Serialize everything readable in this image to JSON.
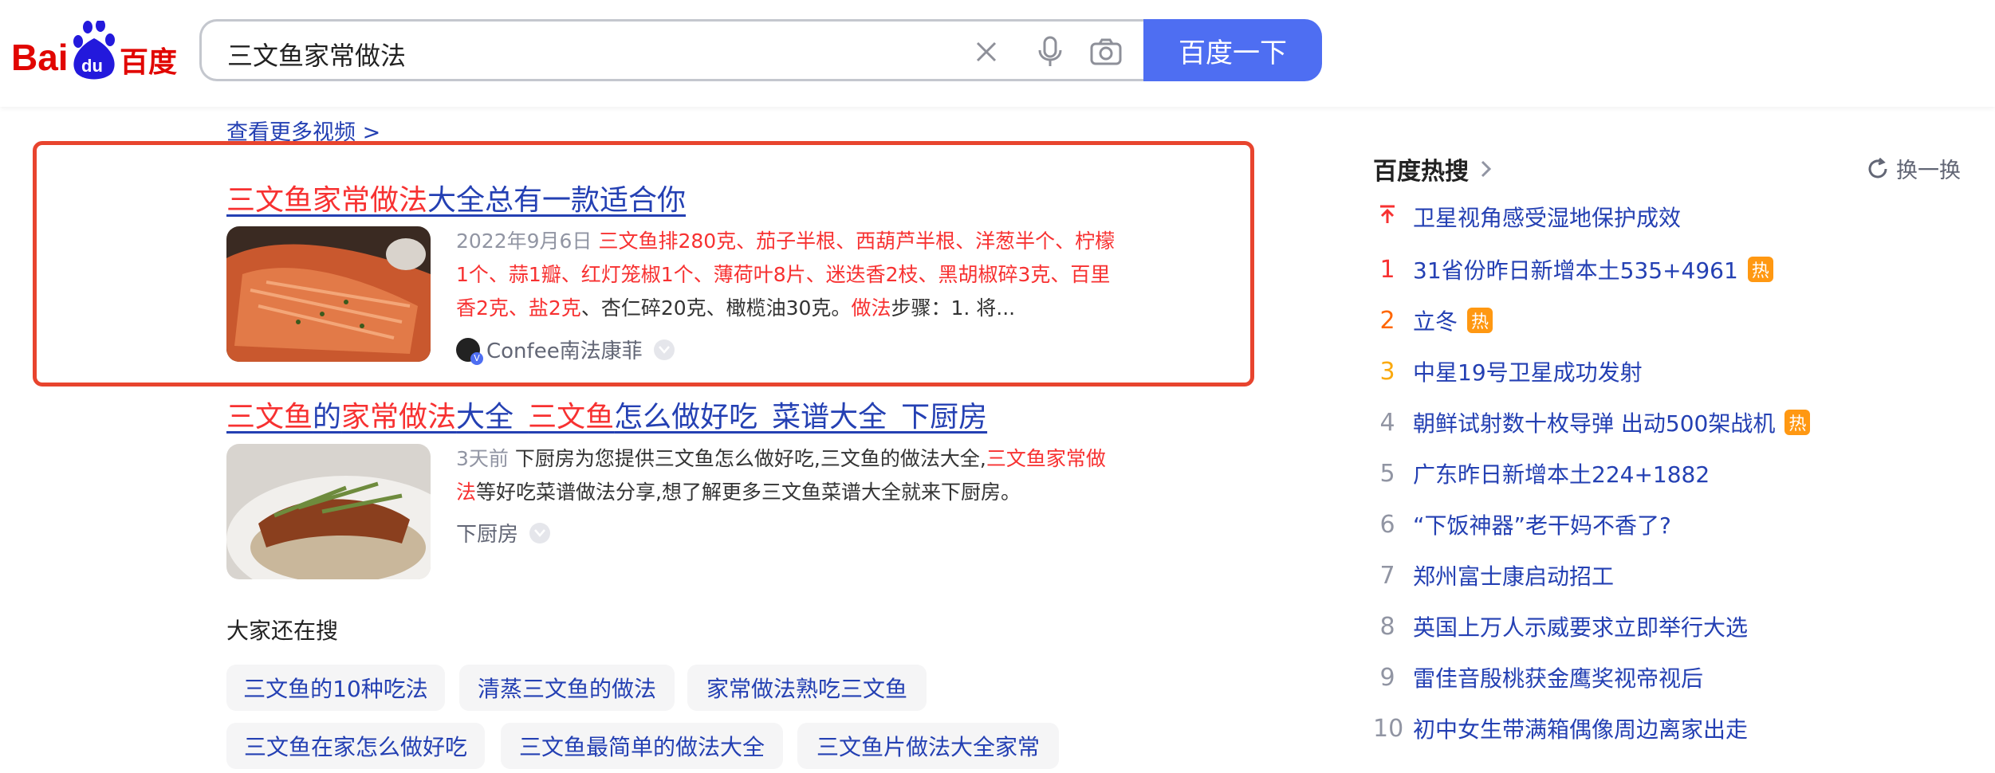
{
  "header": {
    "logo_text": "Bai du 百度",
    "search_value": "三文鱼家常做法",
    "search_button": "百度一下"
  },
  "results": {
    "more_videos": "查看更多视频 >",
    "r1": {
      "title_em": "三文鱼家常做法",
      "title_rest": "大全总有一款适合你",
      "date": "2022年9月6日",
      "snippet_em": "三文鱼排280克、茄子半根、西葫芦半根、洋葱半个、柠檬1个、蒜1瓣、红灯笼椒1个、薄荷叶8片、迷迭香2枝、黑胡椒碎3克、百里香2克、盐2克",
      "snippet_mid": "、杏仁碎20克、橄榄油30克。",
      "snippet_em2": "做法",
      "snippet_end": "步骤：1. 将...",
      "source": "Confee南法康菲"
    },
    "r2": {
      "t1": "三文鱼",
      "t2": "的",
      "t3": "家常做法",
      "t4": "大全_",
      "t5": "三文鱼",
      "t6": "怎么做好吃_菜谱大全_下厨房",
      "date": "3天前",
      "snippet_a": "下厨房为您提供三文鱼怎么做好吃,三文鱼的做法大全,",
      "snippet_em": "三文鱼家常做法",
      "snippet_b": "等好吃菜谱做法分享,想了解更多三文鱼菜谱大全就来下厨房。",
      "source": "下厨房"
    }
  },
  "also_search": {
    "title": "大家还在搜",
    "tags": [
      "三文鱼的10种吃法",
      "清蒸三文鱼的做法",
      "家常做法熟吃三文鱼",
      "三文鱼在家怎么做好吃",
      "三文鱼最简单的做法大全",
      "三文鱼片做法大全家常"
    ]
  },
  "hot": {
    "title": "百度热搜",
    "refresh": "换一换",
    "badge": "热",
    "items": [
      {
        "rank": "",
        "text": "卫星视角感受湿地保护成效",
        "color": "#f73131"
      },
      {
        "rank": "1",
        "text": "31省份昨日新增本土535+4961",
        "color": "#f73131"
      },
      {
        "rank": "2",
        "text": "立冬",
        "color": "#ff6600"
      },
      {
        "rank": "3",
        "text": "中星19号卫星成功发射",
        "color": "#faa90e"
      },
      {
        "rank": "4",
        "text": "朝鲜试射数十枚导弹 出动500架战机",
        "color": "#9195a3"
      },
      {
        "rank": "5",
        "text": "广东昨日新增本土224+1882",
        "color": "#9195a3"
      },
      {
        "rank": "6",
        "text": "“下饭神器”老干妈不香了?",
        "color": "#9195a3"
      },
      {
        "rank": "7",
        "text": "郑州富士康启动招工",
        "color": "#9195a3"
      },
      {
        "rank": "8",
        "text": "英国上万人示威要求立即举行大选",
        "color": "#9195a3"
      },
      {
        "rank": "9",
        "text": "雷佳音殷桃获金鹰奖视帝视后",
        "color": "#9195a3"
      },
      {
        "rank": "10",
        "text": "初中女生带满箱偶像周边离家出走",
        "color": "#9195a3"
      }
    ]
  }
}
